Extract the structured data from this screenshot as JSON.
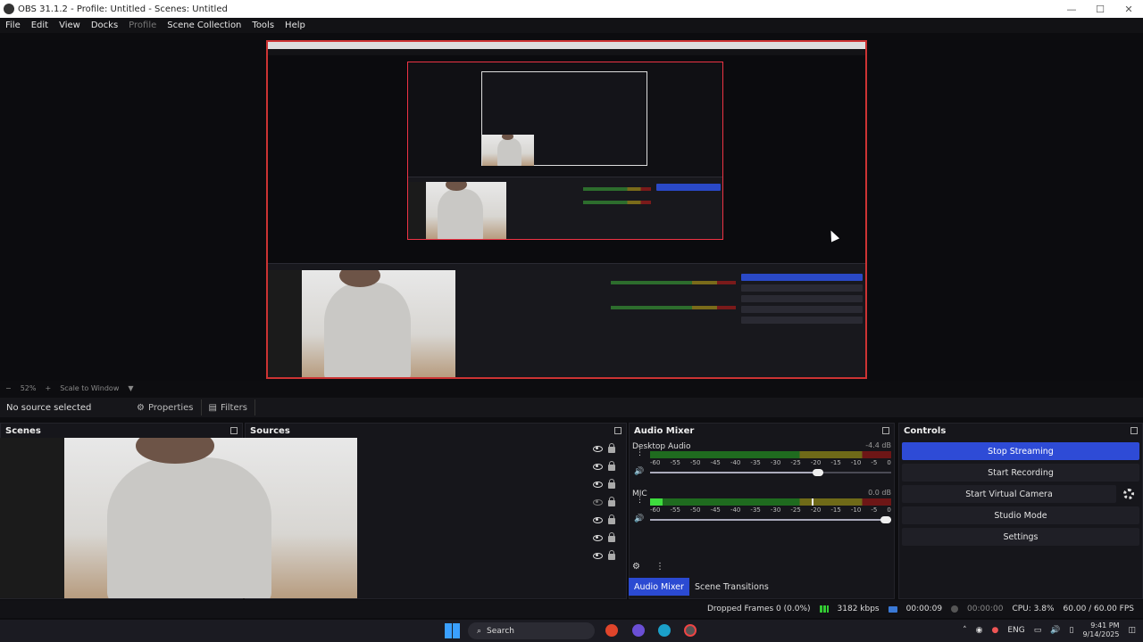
{
  "window": {
    "title": "OBS 31.1.2 - Profile: Untitled - Scenes: Untitled"
  },
  "menu": [
    "File",
    "Edit",
    "View",
    "Docks",
    "Profile",
    "Scene Collection",
    "Tools",
    "Help"
  ],
  "zoom": {
    "percent": "52%",
    "mode": "Scale to Window"
  },
  "context": {
    "no_source": "No source selected",
    "properties": "Properties",
    "filters": "Filters"
  },
  "docks": {
    "scenes": "Scenes",
    "sources": "Sources",
    "mixer": "Audio Mixer",
    "controls": "Controls"
  },
  "mixer": {
    "channels": [
      {
        "name": "Desktop Audio",
        "db": "-4.4 dB",
        "level": 0.0,
        "peak": 0.0,
        "volume": 0.72
      },
      {
        "name": "MIC",
        "db": "0.0 dB",
        "level": 0.05,
        "peak": 0.67,
        "volume": 1.0
      }
    ],
    "ticks": [
      "-60",
      "-55",
      "-50",
      "-45",
      "-40",
      "-35",
      "-30",
      "-25",
      "-20",
      "-15",
      "-10",
      "-5",
      "0"
    ],
    "tabs": {
      "mixer": "Audio Mixer",
      "transitions": "Scene Transitions"
    }
  },
  "controls": {
    "stop_streaming": "Stop Streaming",
    "start_recording": "Start Recording",
    "start_virtual_camera": "Start Virtual Camera",
    "studio_mode": "Studio Mode",
    "settings": "Settings"
  },
  "status": {
    "dropped": "Dropped Frames 0 (0.0%)",
    "bitrate": "3182 kbps",
    "stream_time": "00:00:09",
    "record_time": "00:00:00",
    "cpu": "CPU: 3.8%",
    "fps": "60.00 / 60.00 FPS"
  },
  "taskbar": {
    "search": "Search",
    "lang": "ENG",
    "time": "9:41 PM",
    "date": "9/14/2025"
  },
  "colors": {
    "accent": "#2e4bd6",
    "preview_border": "#cc3333"
  }
}
